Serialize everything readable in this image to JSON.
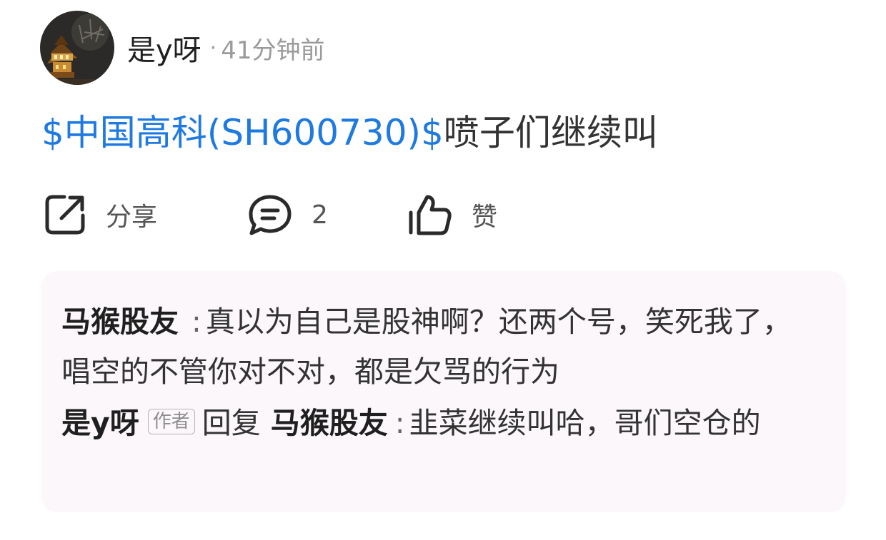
{
  "post": {
    "username": "是y呀",
    "separator": "·",
    "time": "41分钟前",
    "stock_link": "$中国高科(SH600730)$",
    "text": "喷子们继续叫"
  },
  "actions": {
    "share_label": "分享",
    "comment_count": "2",
    "like_label": "赞"
  },
  "comments": [
    {
      "author": "马猴股友",
      "colon": ":",
      "text": "真以为自己是股神啊？还两个号，笑死我了，唱空的不管你对不对，都是欠骂的行为"
    },
    {
      "author": "是y呀",
      "badge": "作者",
      "reply_word": "回复",
      "reply_to": "马猴股友",
      "colon": ":",
      "text": "韭菜继续叫哈，哥们空仓的"
    }
  ],
  "colors": {
    "link": "#1e7ae0",
    "secondary_text": "#9a9a9a",
    "comment_bg": "#fbf7fb"
  },
  "icons": {
    "share": "share-icon",
    "comment": "comment-bubble-icon",
    "like": "thumbs-up-icon"
  }
}
